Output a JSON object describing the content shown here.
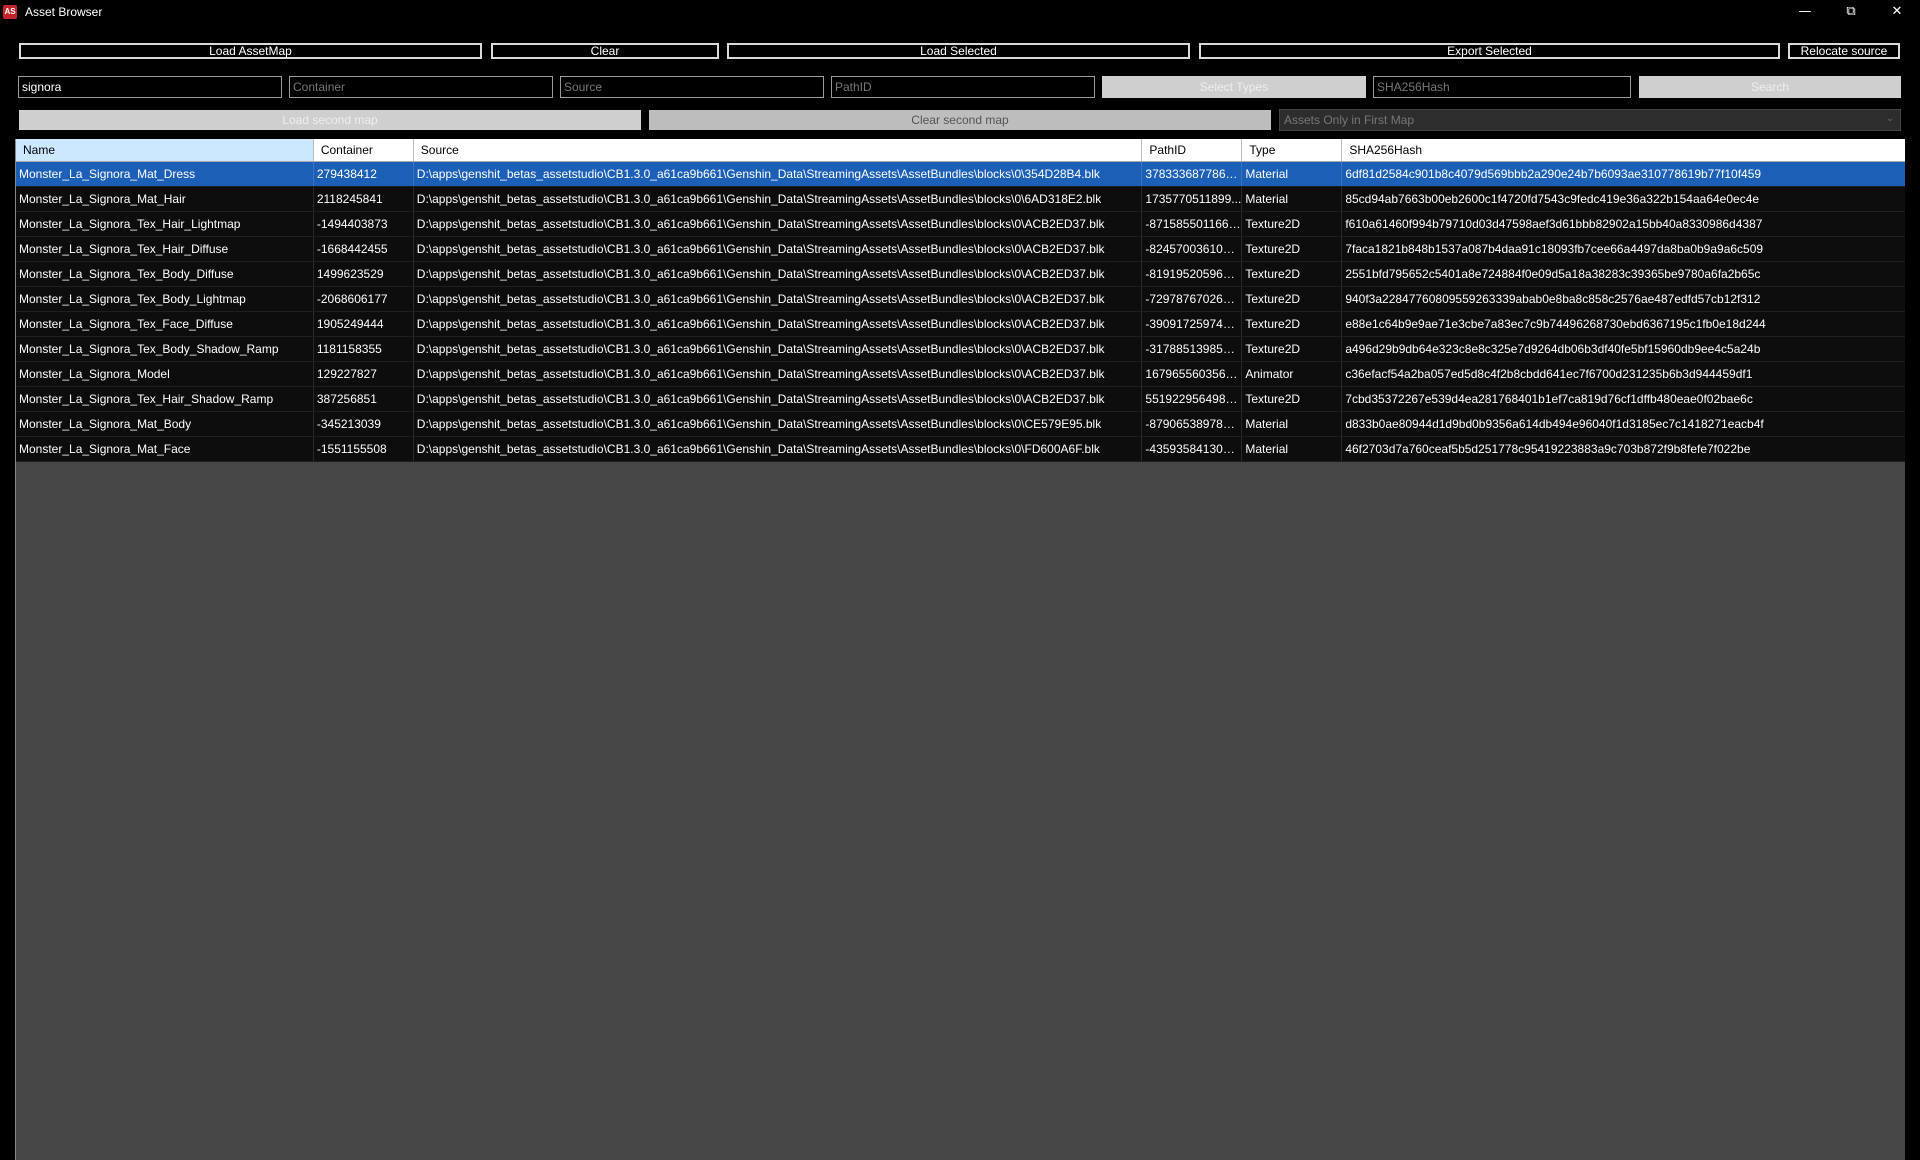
{
  "window": {
    "title": "Asset Browser",
    "icon_text": "AS"
  },
  "toolbar": {
    "load_assetmap": "Load AssetMap",
    "clear": "Clear",
    "load_selected": "Load Selected",
    "export_selected": "Export Selected",
    "relocate_source": "Relocate source"
  },
  "filters": {
    "name_value": "signora",
    "container_placeholder": "Container",
    "source_placeholder": "Source",
    "pathid_placeholder": "PathID",
    "select_types": "Select Types",
    "hash_placeholder": "SHA256Hash",
    "search": "Search"
  },
  "second_map": {
    "load": "Load second map",
    "clear": "Clear second map",
    "mode": "Assets Only in First Map"
  },
  "table": {
    "headers": [
      "Name",
      "Container",
      "Source",
      "PathID",
      "Type",
      "SHA256Hash"
    ],
    "rows": [
      {
        "name": "Monster_La_Signora_Mat_Dress",
        "container": "279438412",
        "source": "D:\\apps\\genshit_betas_assetstudio\\CB1.3.0_a61ca9b661\\Genshin_Data\\StreamingAssets\\AssetBundles\\blocks\\0\\354D28B4.blk",
        "pathid": "3783336877860...",
        "type": "Material",
        "hash": "6df81d2584c901b8c4079d569bbb2a290e24b7b6093ae310778619b77f10f459"
      },
      {
        "name": "Monster_La_Signora_Mat_Hair",
        "container": "2118245841",
        "source": "D:\\apps\\genshit_betas_assetstudio\\CB1.3.0_a61ca9b661\\Genshin_Data\\StreamingAssets\\AssetBundles\\blocks\\0\\6AD318E2.blk",
        "pathid": "1735770511899...",
        "type": "Material",
        "hash": "85cd94ab7663b00eb2600c1f4720fd7543c9fedc419e36a322b154aa64e0ec4e"
      },
      {
        "name": "Monster_La_Signora_Tex_Hair_Lightmap",
        "container": "-1494403873",
        "source": "D:\\apps\\genshit_betas_assetstudio\\CB1.3.0_a61ca9b661\\Genshin_Data\\StreamingAssets\\AssetBundles\\blocks\\0\\ACB2ED37.blk",
        "pathid": "-8715855011664...",
        "type": "Texture2D",
        "hash": "f610a61460f994b79710d03d47598aef3d61bbb82902a15bb40a8330986d4387"
      },
      {
        "name": "Monster_La_Signora_Tex_Hair_Diffuse",
        "container": "-1668442455",
        "source": "D:\\apps\\genshit_betas_assetstudio\\CB1.3.0_a61ca9b661\\Genshin_Data\\StreamingAssets\\AssetBundles\\blocks\\0\\ACB2ED37.blk",
        "pathid": "-8245700361065...",
        "type": "Texture2D",
        "hash": "7faca1821b848b1537a087b4daa91c18093fb7cee66a4497da8ba0b9a9a6c509"
      },
      {
        "name": "Monster_La_Signora_Tex_Body_Diffuse",
        "container": "1499623529",
        "source": "D:\\apps\\genshit_betas_assetstudio\\CB1.3.0_a61ca9b661\\Genshin_Data\\StreamingAssets\\AssetBundles\\blocks\\0\\ACB2ED37.blk",
        "pathid": "-8191952059642...",
        "type": "Texture2D",
        "hash": "2551bfd795652c5401a8e724884f0e09d5a18a38283c39365be9780a6fa2b65c"
      },
      {
        "name": "Monster_La_Signora_Tex_Body_Lightmap",
        "container": "-2068606177",
        "source": "D:\\apps\\genshit_betas_assetstudio\\CB1.3.0_a61ca9b661\\Genshin_Data\\StreamingAssets\\AssetBundles\\blocks\\0\\ACB2ED37.blk",
        "pathid": "-7297876702665...",
        "type": "Texture2D",
        "hash": "940f3a22847760809559263339abab0e8ba8c858c2576ae487edfd57cb12f312"
      },
      {
        "name": "Monster_La_Signora_Tex_Face_Diffuse",
        "container": "1905249444",
        "source": "D:\\apps\\genshit_betas_assetstudio\\CB1.3.0_a61ca9b661\\Genshin_Data\\StreamingAssets\\AssetBundles\\blocks\\0\\ACB2ED37.blk",
        "pathid": "-3909172597406...",
        "type": "Texture2D",
        "hash": "e88e1c64b9e9ae71e3cbe7a83ec7c9b74496268730ebd6367195c1fb0e18d244"
      },
      {
        "name": "Monster_La_Signora_Tex_Body_Shadow_Ramp",
        "container": "1181158355",
        "source": "D:\\apps\\genshit_betas_assetstudio\\CB1.3.0_a61ca9b661\\Genshin_Data\\StreamingAssets\\AssetBundles\\blocks\\0\\ACB2ED37.blk",
        "pathid": "-3178851398526...",
        "type": "Texture2D",
        "hash": "a496d29b9db64e323c8e8c325e7d9264db06b3df40fe5bf15960db9ee4c5a24b"
      },
      {
        "name": "Monster_La_Signora_Model",
        "container": "129227827",
        "source": "D:\\apps\\genshit_betas_assetstudio\\CB1.3.0_a61ca9b661\\Genshin_Data\\StreamingAssets\\AssetBundles\\blocks\\0\\ACB2ED37.blk",
        "pathid": "1679655603564...",
        "type": "Animator",
        "hash": "c36efacf54a2ba057ed5d8c4f2b8cbdd641ec7f6700d231235b6b3d944459df1"
      },
      {
        "name": "Monster_La_Signora_Tex_Hair_Shadow_Ramp",
        "container": "387256851",
        "source": "D:\\apps\\genshit_betas_assetstudio\\CB1.3.0_a61ca9b661\\Genshin_Data\\StreamingAssets\\AssetBundles\\blocks\\0\\ACB2ED37.blk",
        "pathid": "5519229564981...",
        "type": "Texture2D",
        "hash": "7cbd35372267e539d4ea281768401b1ef7ca819d76cf1dffb480eae0f02bae6c"
      },
      {
        "name": "Monster_La_Signora_Mat_Body",
        "container": "-345213039",
        "source": "D:\\apps\\genshit_betas_assetstudio\\CB1.3.0_a61ca9b661\\Genshin_Data\\StreamingAssets\\AssetBundles\\blocks\\0\\CE579E95.blk",
        "pathid": "-8790653897870...",
        "type": "Material",
        "hash": "d833b0ae80944d1d9bd0b9356a614db494e96040f1d3185ec7c1418271eacb4f"
      },
      {
        "name": "Monster_La_Signora_Mat_Face",
        "container": "-1551155508",
        "source": "D:\\apps\\genshit_betas_assetstudio\\CB1.3.0_a61ca9b661\\Genshin_Data\\StreamingAssets\\AssetBundles\\blocks\\0\\FD600A6F.blk",
        "pathid": "-4359358413001...",
        "type": "Material",
        "hash": "46f2703d7a760ceaf5b5d251778c95419223883a9c703b872f9b8fefe7f022be"
      }
    ],
    "selected_row": 0
  },
  "colors": {
    "selection": "#1c5fb7",
    "grid_background": "#464646"
  }
}
